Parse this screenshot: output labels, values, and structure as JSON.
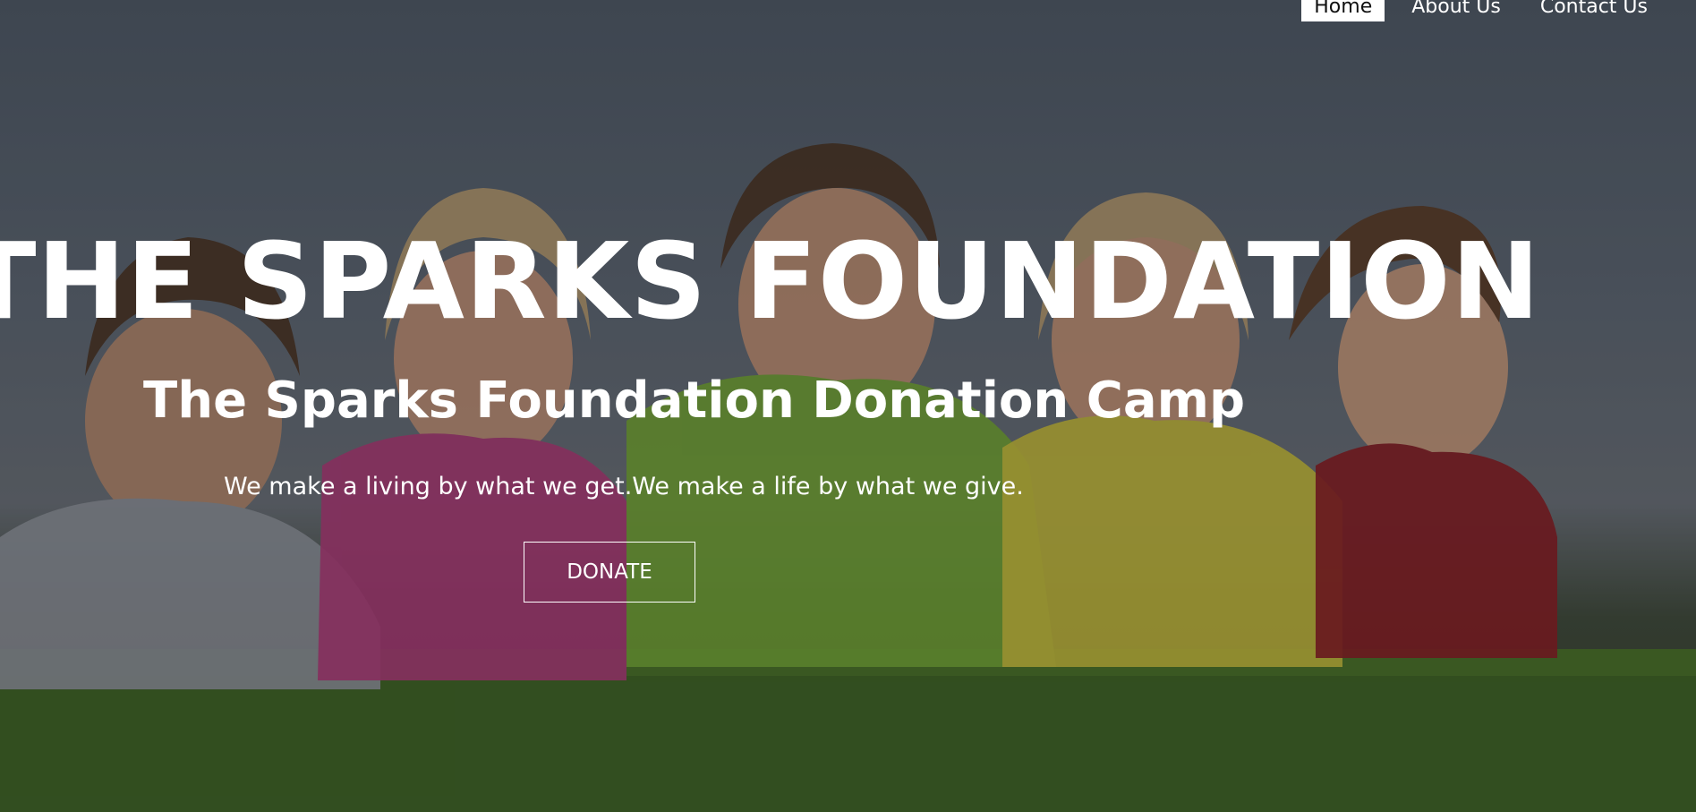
{
  "nav": {
    "items": [
      {
        "label": "Home",
        "active": true
      },
      {
        "label": "About Us",
        "active": false
      },
      {
        "label": "Contact Us",
        "active": false
      }
    ]
  },
  "hero": {
    "title": "THE SPARKS FOUNDATION",
    "subtitle": "The Sparks Foundation Donation Camp",
    "tagline": "We make a living by what we get.We make a life by what we give.",
    "donate_label": "DONATE"
  },
  "colors": {
    "nav_active_bg": "#ffffff",
    "text": "#ffffff",
    "shirt_grey": "#8f949c",
    "shirt_pink": "#b03a78",
    "shirt_green": "#74a833",
    "shirt_yellow": "#c9bf3a",
    "shirt_red": "#8a1c22",
    "grass": "#3f6a22"
  }
}
